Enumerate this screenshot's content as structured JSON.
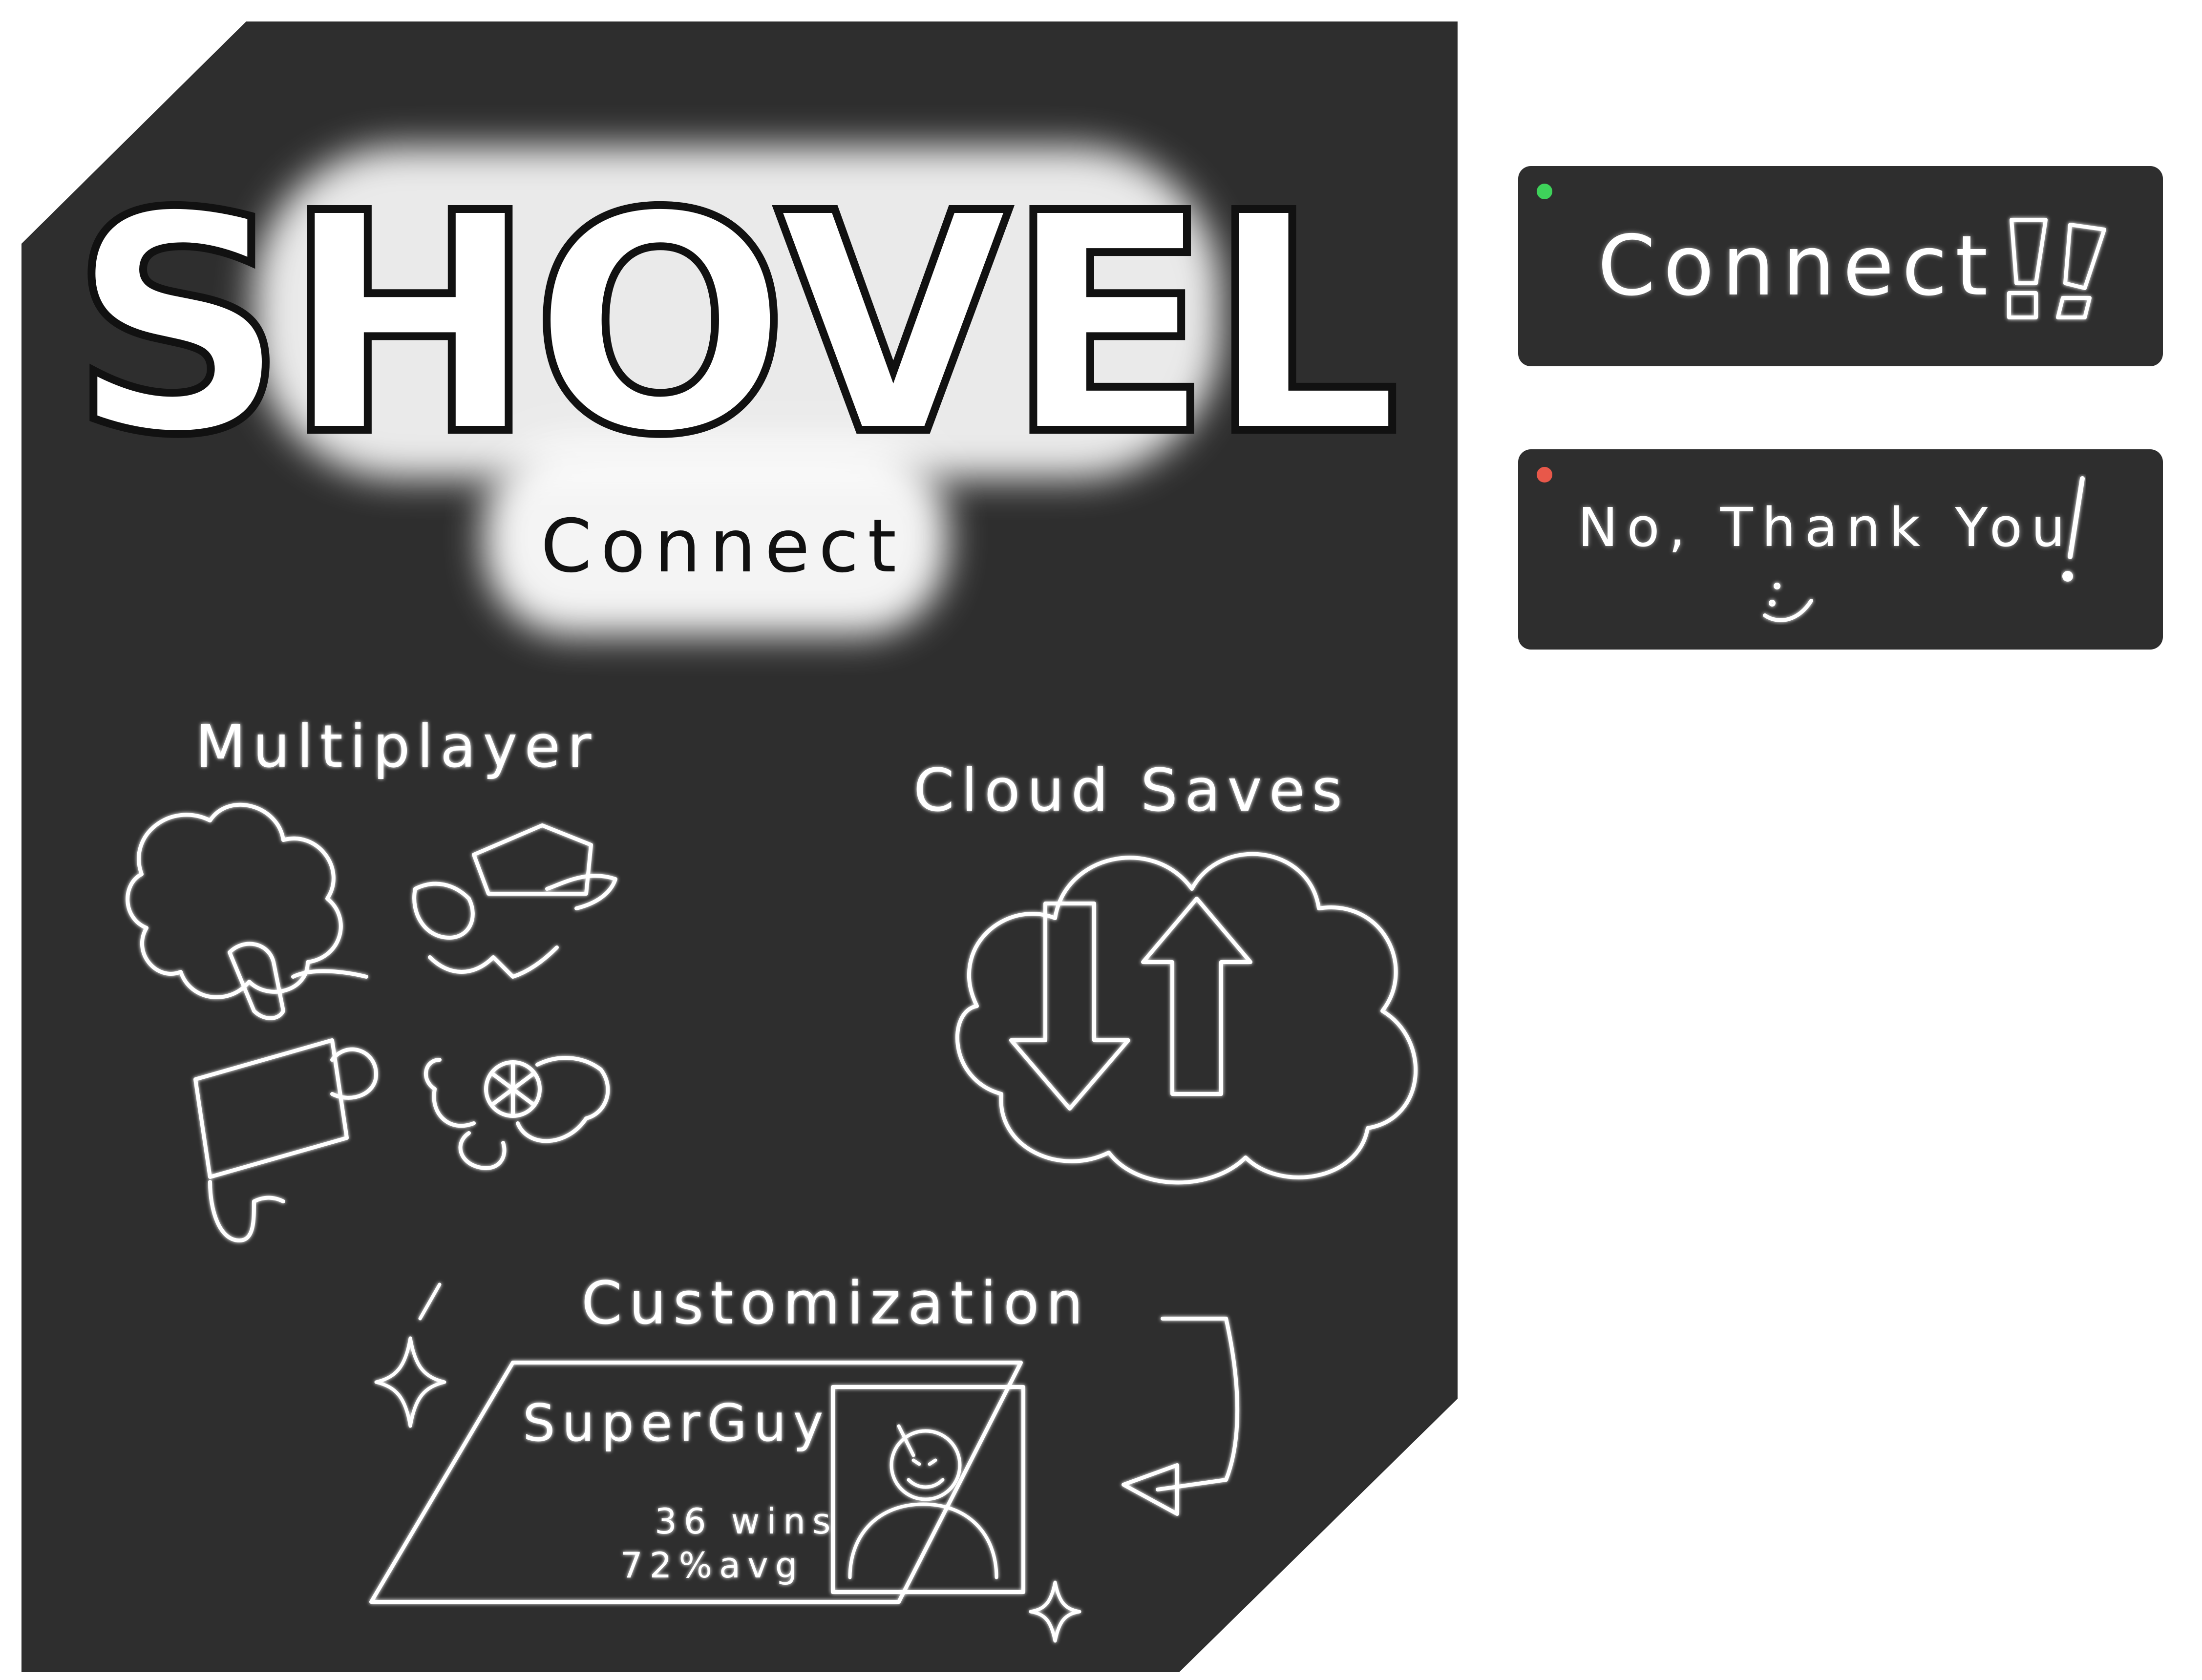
{
  "colors": {
    "panel": "#2e2e2e",
    "chalk": "#ffffff",
    "connect_dot": "#3ed25a",
    "decline_dot": "#e8584a"
  },
  "logo": {
    "word": "SHOVEL",
    "subtitle": "Connect"
  },
  "features": {
    "multiplayer": {
      "label": "Multiplayer",
      "icon": "two-players-icon"
    },
    "cloud_saves": {
      "label": "Cloud Saves",
      "icon": "cloud-sync-icon"
    },
    "customization": {
      "label": "Customization",
      "icon": "profile-card-icon",
      "card": {
        "username": "SuperGuy",
        "wins": "36 wins",
        "avg": "72%avg"
      }
    }
  },
  "buttons": {
    "connect": {
      "label": "Connect",
      "icon": "double-exclamation-icon"
    },
    "decline": {
      "label": "No, Thank You",
      "icon": "smiley-icon"
    }
  }
}
